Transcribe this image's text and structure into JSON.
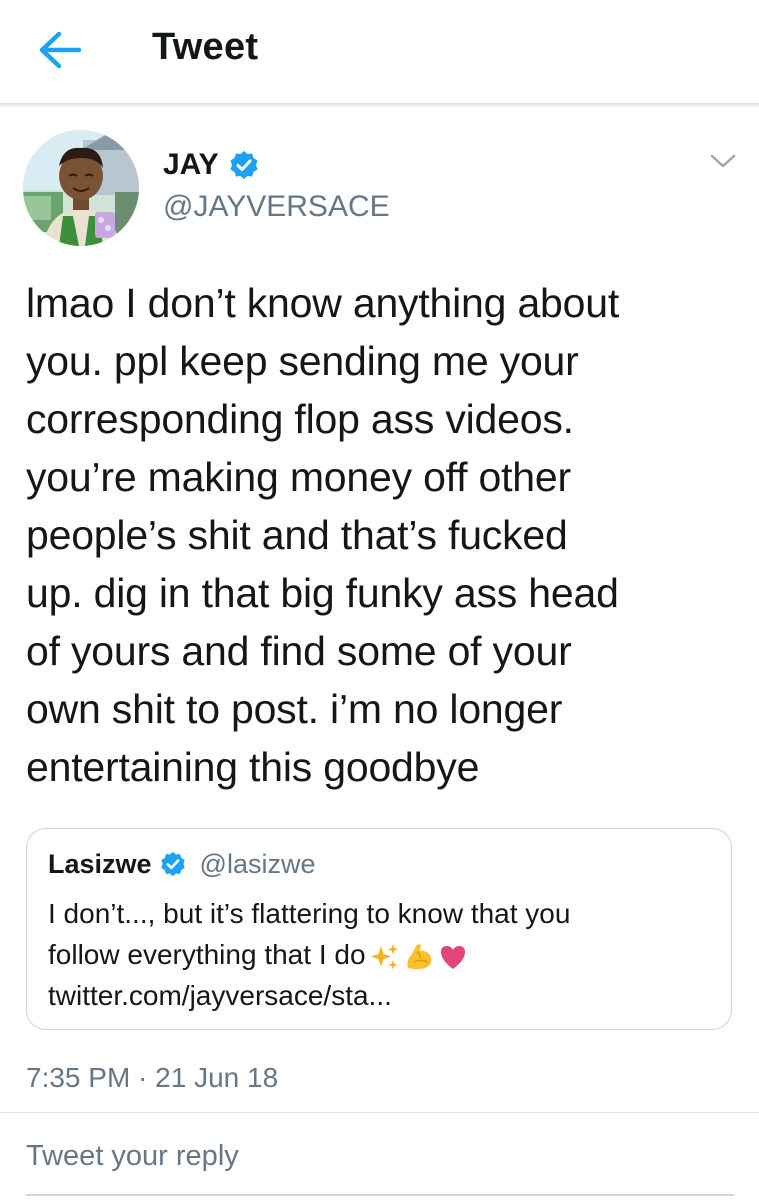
{
  "header": {
    "title": "Tweet",
    "back_icon": "arrow-left-icon",
    "accent_color": "#1da1f2"
  },
  "tweet": {
    "author": {
      "name": "JAY",
      "handle": "@JAYVERSACE",
      "verified": true
    },
    "text": "lmao I don’t know anything about\nyou. ppl keep sending me your\ncorresponding flop ass videos.\nyou’re making money off other\npeople’s shit and that’s fucked\nup. dig in that big funky ass head\nof yours and find some of your\nown shit to post. i’m no longer\nentertaining this goodbye",
    "timestamp": "7:35 PM · 21 Jun 18"
  },
  "quoted_tweet": {
    "name": "Lasizwe",
    "handle": "@lasizwe",
    "verified": true,
    "text_line1": "I don’t..., but it’s flattering to know that you",
    "text_line2": "follow everything that I do",
    "emojis": [
      "sparkles-icon",
      "flexed-biceps-icon",
      "heart-icon"
    ],
    "link": "twitter.com/jayversace/sta..."
  },
  "reply": {
    "placeholder": "Tweet your reply"
  }
}
